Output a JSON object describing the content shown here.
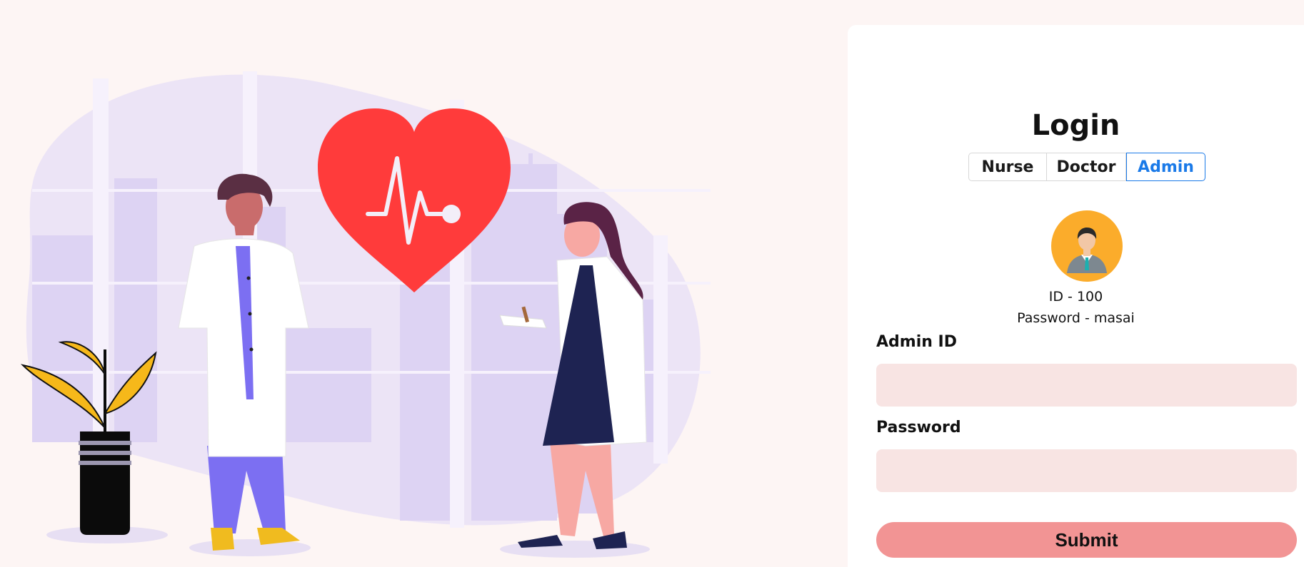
{
  "login": {
    "title": "Login",
    "tabs": [
      {
        "label": "Nurse",
        "active": false
      },
      {
        "label": "Doctor",
        "active": false
      },
      {
        "label": "Admin",
        "active": true
      }
    ],
    "credentials": {
      "id_text": "ID - 100",
      "password_text": "Password - masai"
    },
    "fields": {
      "admin_id_label": "Admin ID",
      "admin_id_value": "",
      "password_label": "Password",
      "password_value": ""
    },
    "submit_label": "Submit"
  },
  "colors": {
    "page_background": "#fdf5f4",
    "card_background": "#ffffff",
    "input_background": "#f8e4e3",
    "submit_background": "#f29494",
    "active_tab": "#1a7ae8",
    "avatar_background": "#fbac2b",
    "heart": "#ff3b3b",
    "blob": "#ece4f6"
  }
}
